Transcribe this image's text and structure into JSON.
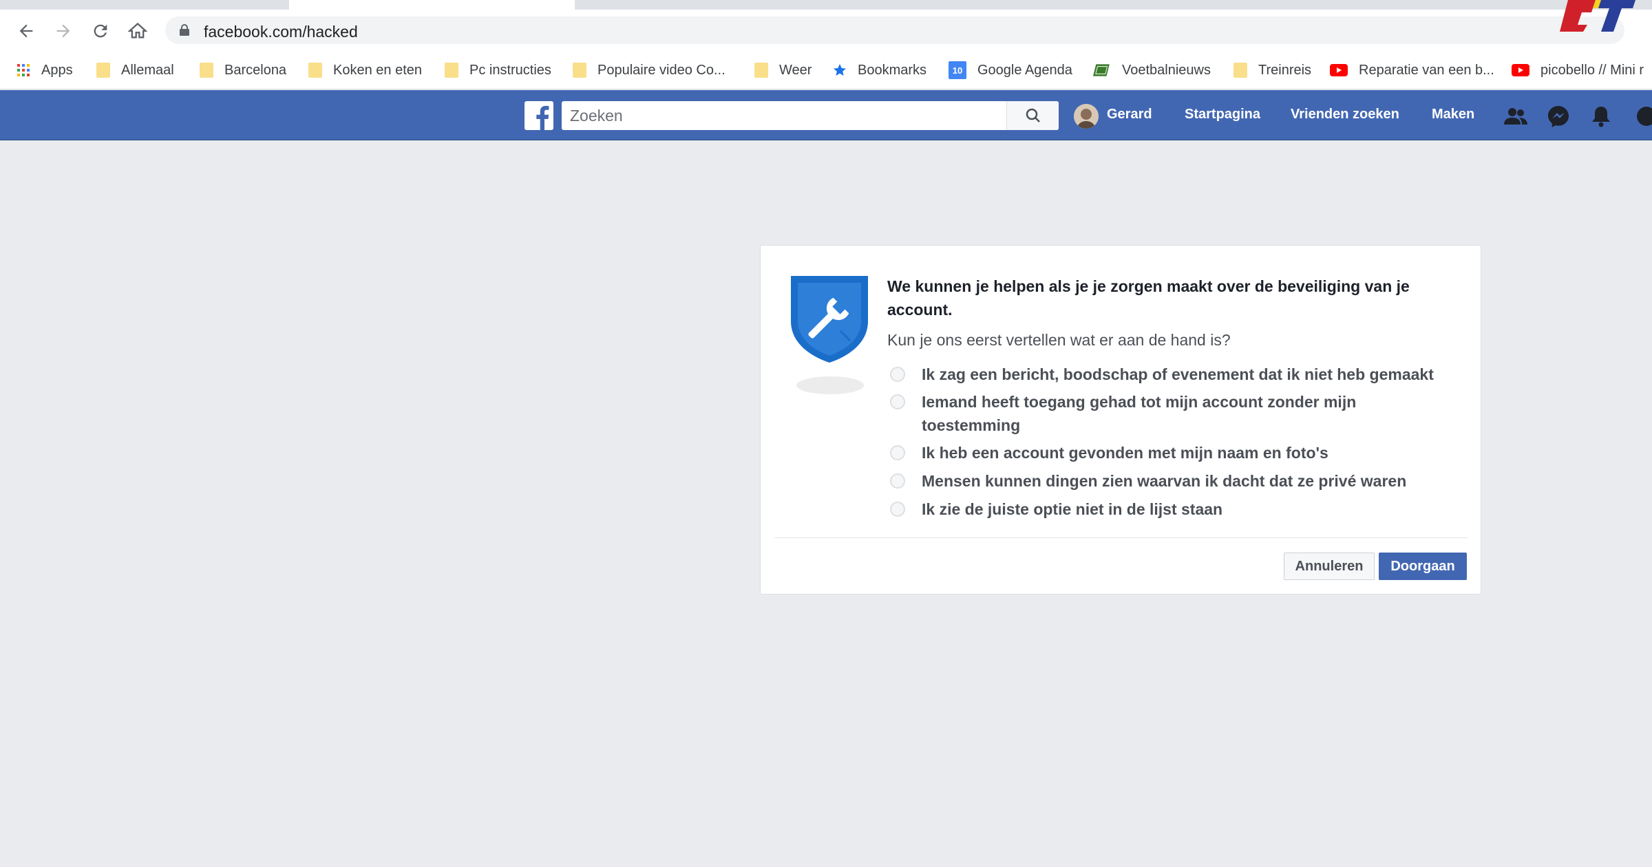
{
  "browser": {
    "url": "facebook.com/hacked",
    "bookmarks": [
      {
        "label": "Apps",
        "icon": "apps-grid-icon"
      },
      {
        "label": "Allemaal",
        "icon": "folder-icon"
      },
      {
        "label": "Barcelona",
        "icon": "folder-icon"
      },
      {
        "label": "Koken en eten",
        "icon": "folder-icon"
      },
      {
        "label": "Pc instructies",
        "icon": "folder-icon"
      },
      {
        "label": "Populaire video Co...",
        "icon": "folder-icon"
      },
      {
        "label": "Weer",
        "icon": "folder-icon"
      },
      {
        "label": "Bookmarks",
        "icon": "star-icon"
      },
      {
        "label": "Google Agenda",
        "icon": "calendar-icon",
        "badge": "10"
      },
      {
        "label": "Voetbalnieuws",
        "icon": "pitch-icon"
      },
      {
        "label": "Treinreis",
        "icon": "folder-icon"
      },
      {
        "label": "Reparatie van een b...",
        "icon": "youtube-icon"
      },
      {
        "label": "picobello // Mini r",
        "icon": "youtube-icon"
      }
    ]
  },
  "facebook": {
    "search_placeholder": "Zoeken",
    "user_name": "Gerard",
    "nav": {
      "home": "Startpagina",
      "find_friends": "Vrienden zoeken",
      "create": "Maken"
    }
  },
  "dialog": {
    "heading": "We kunnen je helpen als je je zorgen maakt over de beveiliging van je account.",
    "question": "Kun je ons eerst vertellen wat er aan de hand is?",
    "options": [
      "Ik zag een bericht, boodschap of evenement dat ik niet heb gemaakt",
      "Iemand heeft toegang gehad tot mijn account zonder mijn toestemming",
      "Ik heb een account gevonden met mijn naam en foto's",
      "Mensen kunnen dingen zien waarvan ik dacht dat ze privé waren",
      "Ik zie de juiste optie niet in de lijst staan"
    ],
    "cancel_label": "Annuleren",
    "continue_label": "Doorgaan"
  },
  "colors": {
    "facebook_blue": "#4267b2",
    "page_background": "#e9ebee",
    "shield_blue": "#1a6dc9"
  }
}
